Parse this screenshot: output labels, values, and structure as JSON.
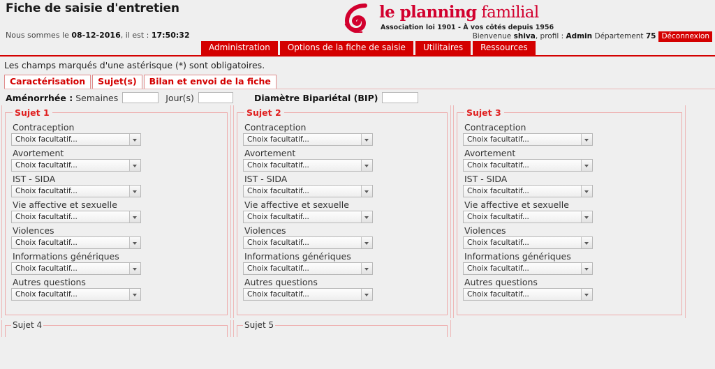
{
  "header": {
    "title": "Fiche de saisie d'entretien",
    "datetime_prefix": "Nous sommes le ",
    "date": "08-12-2016",
    "datetime_middle": ", il est : ",
    "time": "17:50:32",
    "logo": {
      "name_bold": "le planning",
      "name_light": " familial",
      "tagline": "Association loi 1901 - À vos côtés depuis 1956",
      "mark_icon": "spiral-logo-icon",
      "color": "#d2002e"
    },
    "welcome": {
      "prefix": "Bienvenue ",
      "user": "shiva",
      "middle": ", profil : ",
      "profile": "Admin",
      "dept_label": " Département ",
      "dept": "75",
      "logout_label": "Déconnexion"
    }
  },
  "nav": {
    "items": [
      {
        "label": "Administration"
      },
      {
        "label": "Options de la fiche de saisie"
      },
      {
        "label": "Utilitaires"
      },
      {
        "label": "Ressources"
      }
    ],
    "color": "#d40000"
  },
  "notice": "Les champs marqués d'une astérisque (*) sont obligatoires.",
  "subtabs": [
    {
      "label": "Caractérisation",
      "active": false
    },
    {
      "label": "Sujet(s)",
      "active": true
    },
    {
      "label": "Bilan et envoi de la fiche",
      "active": false
    }
  ],
  "amenorrhee": {
    "title": "Aménorrhée :",
    "weeks_label": "Semaines",
    "weeks_value": "",
    "days_label": "Jour(s)",
    "days_value": "",
    "bip_label": "Diamètre Bipariétal (BIP)",
    "bip_value": ""
  },
  "select_placeholder": "Choix facultatif...",
  "field_labels": [
    "Contraception",
    "Avortement",
    "IST - SIDA",
    "Vie affective et sexuelle",
    "Violences",
    "Informations génériques",
    "Autres questions"
  ],
  "subjects": [
    {
      "legend": "Sujet 1"
    },
    {
      "legend": "Sujet 2"
    },
    {
      "legend": "Sujet 3"
    }
  ],
  "subjects_bottom": [
    {
      "legend": "Sujet 4"
    },
    {
      "legend": "Sujet 5"
    }
  ],
  "colors": {
    "brand_red": "#d40000",
    "legend_red": "#e02020",
    "page_bg": "#efefef",
    "fieldset_border": "#eeaaaa"
  }
}
